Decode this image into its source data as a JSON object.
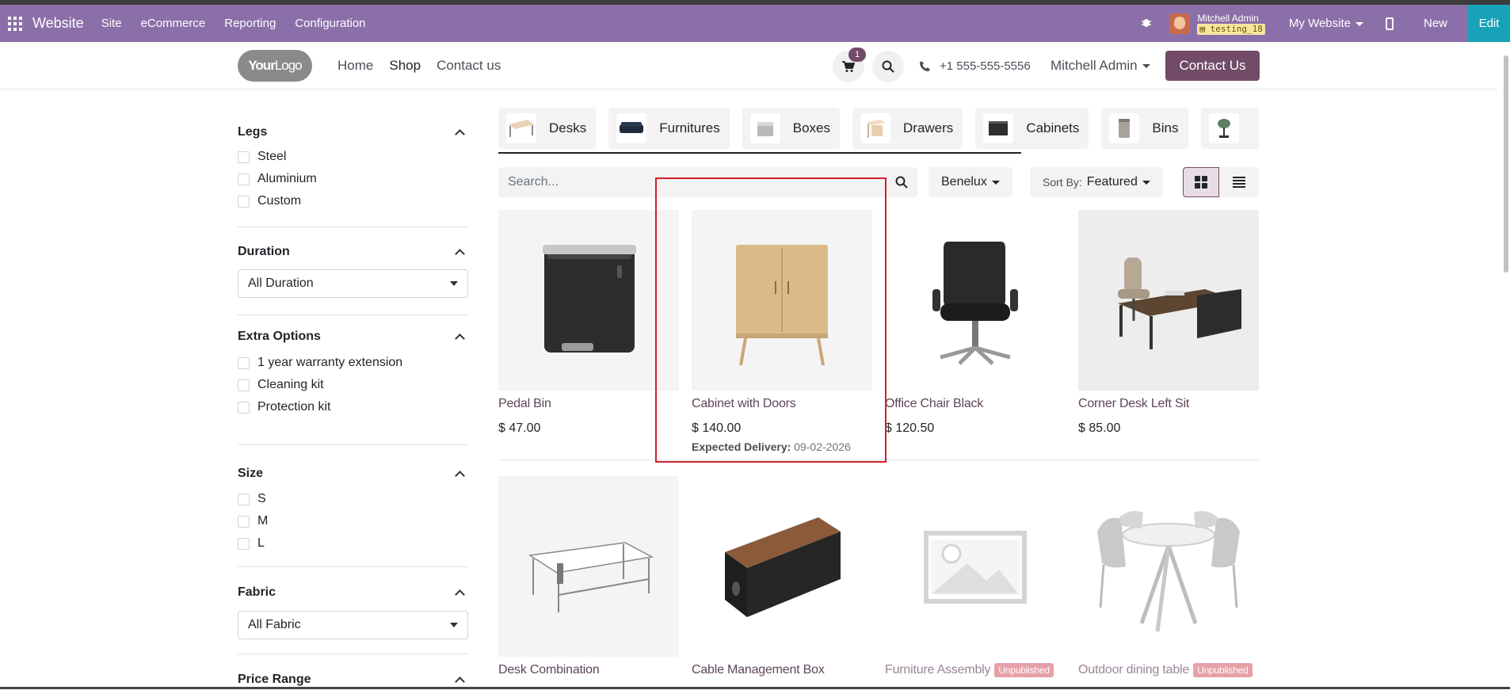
{
  "admin_bar": {
    "brand": "Website",
    "menus": [
      "Site",
      "eCommerce",
      "Reporting",
      "Configuration"
    ],
    "user_name": "Mitchell Admin",
    "database": "testing_18",
    "website_switch": "My Website",
    "new_label": "New",
    "edit_label": "Edit"
  },
  "site_header": {
    "logo_text_a": "Your",
    "logo_text_b": "Logo",
    "nav": [
      "Home",
      "Shop",
      "Contact us"
    ],
    "active_nav": "Shop",
    "cart_count": "1",
    "phone": "+1 555-555-5556",
    "user_menu": "Mitchell Admin",
    "contact_button": "Contact Us"
  },
  "filters": {
    "legs": {
      "title": "Legs",
      "options": [
        "Steel",
        "Aluminium",
        "Custom"
      ]
    },
    "duration": {
      "title": "Duration",
      "selected": "All Duration"
    },
    "extra_options": {
      "title": "Extra Options",
      "options": [
        "1 year warranty extension",
        "Cleaning kit",
        "Protection kit"
      ]
    },
    "size": {
      "title": "Size",
      "options": [
        "S",
        "M",
        "L"
      ]
    },
    "fabric": {
      "title": "Fabric",
      "selected": "All Fabric"
    },
    "price_range": {
      "title": "Price Range"
    }
  },
  "categories": [
    "Desks",
    "Furnitures",
    "Boxes",
    "Drawers",
    "Cabinets",
    "Bins"
  ],
  "toolbar": {
    "search_placeholder": "Search...",
    "pricelist": "Benelux",
    "sort_label": "Sort By:",
    "sort_value": "Featured"
  },
  "products": [
    {
      "name": "Pedal Bin",
      "price": "$ 47.00"
    },
    {
      "name": "Cabinet with Doors",
      "price": "$ 140.00",
      "delivery_label": "Expected Delivery:",
      "delivery_date": "09-02-2026"
    },
    {
      "name": "Office Chair Black",
      "price": "$ 120.50"
    },
    {
      "name": "Corner Desk Left Sit",
      "price": "$ 85.00"
    },
    {
      "name": "Desk Combination"
    },
    {
      "name": "Cable Management Box"
    },
    {
      "name": "Furniture Assembly",
      "badge": "Unpublished"
    },
    {
      "name": "Outdoor dining table",
      "badge": "Unpublished"
    }
  ],
  "colors": {
    "admin_bar": "#8b6fa8",
    "primary": "#714b67",
    "edit": "#17a2b8",
    "highlight": "#d0202b"
  }
}
